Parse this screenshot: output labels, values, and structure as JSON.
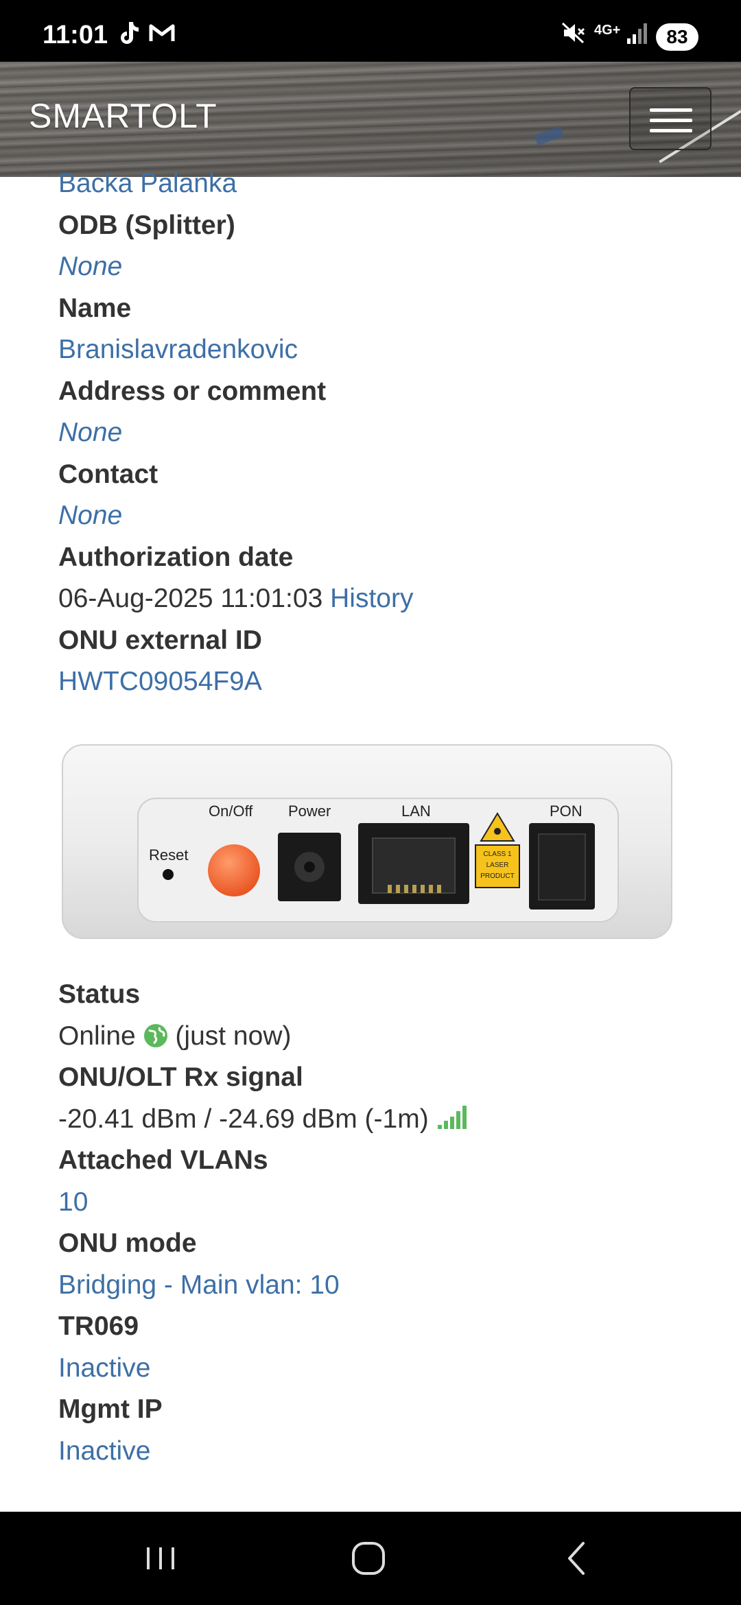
{
  "status_bar": {
    "time": "11:01",
    "battery": "83",
    "network": "4G+",
    "icons": [
      "tiktok-icon",
      "gmail-icon",
      "mute-icon",
      "network-4g-icon",
      "signal-icon",
      "battery-icon"
    ]
  },
  "navbar": {
    "brand": "SMARTOLT",
    "menu_icon": "hamburger-icon"
  },
  "details_top": {
    "zone_value": "Backa Palanka",
    "odb_label": "ODB (Splitter)",
    "odb_value": "None",
    "name_label": "Name",
    "name_value": "Branislavradenkovic",
    "address_label": "Address or comment",
    "address_value": "None",
    "contact_label": "Contact",
    "contact_value": "None",
    "auth_label": "Authorization date",
    "auth_value": "06-Aug-2025 11:01:03",
    "auth_history_link": "History",
    "external_id_label": "ONU external ID",
    "external_id_value": "HWTC09054F9A"
  },
  "device_image": {
    "labels": {
      "reset": "Reset",
      "onoff": "On/Off",
      "power": "Power",
      "lan": "LAN",
      "pon": "PON",
      "laser": [
        "CLASS 1",
        "LASER",
        "PRODUCT"
      ]
    }
  },
  "details_bottom": {
    "status_label": "Status",
    "status_value": "Online",
    "status_suffix": "(just now)",
    "rx_label": "ONU/OLT Rx signal",
    "rx_value": "-20.41 dBm / -24.69 dBm (-1m)",
    "vlans_label": "Attached VLANs",
    "vlans_value": "10",
    "mode_label": "ONU mode",
    "mode_value": "Bridging - Main vlan: 10",
    "tr069_label": "TR069",
    "tr069_value": "Inactive",
    "mgmt_label": "Mgmt IP",
    "mgmt_value": "Inactive"
  },
  "colors": {
    "link": "#3d6fa6",
    "label": "#333333",
    "online_globe": "#5cb85c",
    "signal_green": "#5cb85c"
  },
  "bottom_nav": {
    "icons": [
      "recent-apps-icon",
      "home-icon",
      "back-icon"
    ]
  }
}
